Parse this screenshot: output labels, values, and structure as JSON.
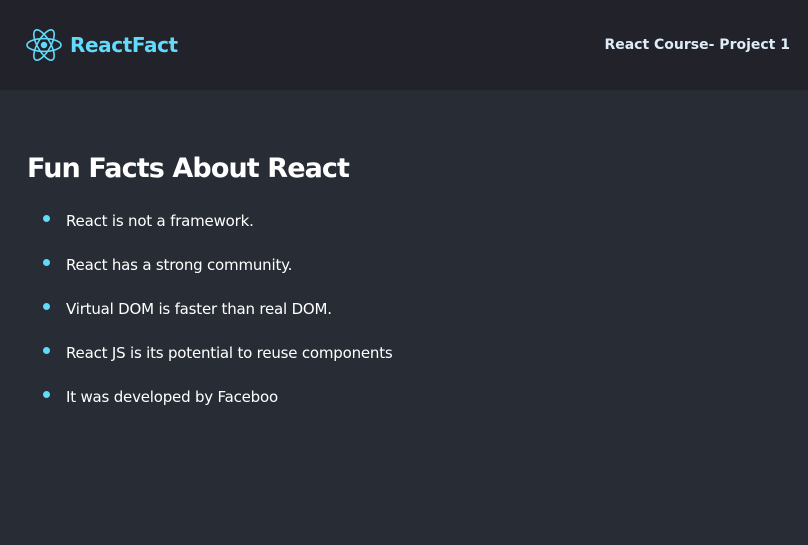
{
  "navbar": {
    "logo_icon": "react-atom-icon",
    "brand": "ReactFact",
    "title": "React Course- Project 1"
  },
  "main": {
    "title": "Fun Facts About React",
    "facts": [
      "React is not a framework.",
      "React has a strong community.",
      "Virtual DOM is faster than real DOM.",
      "React JS is its potential to reuse components",
      "It was developed by Faceboo"
    ]
  },
  "colors": {
    "accent": "#61dafb",
    "navbar_bg": "#21222a",
    "page_bg": "#282d35",
    "text": "#ffffff"
  }
}
